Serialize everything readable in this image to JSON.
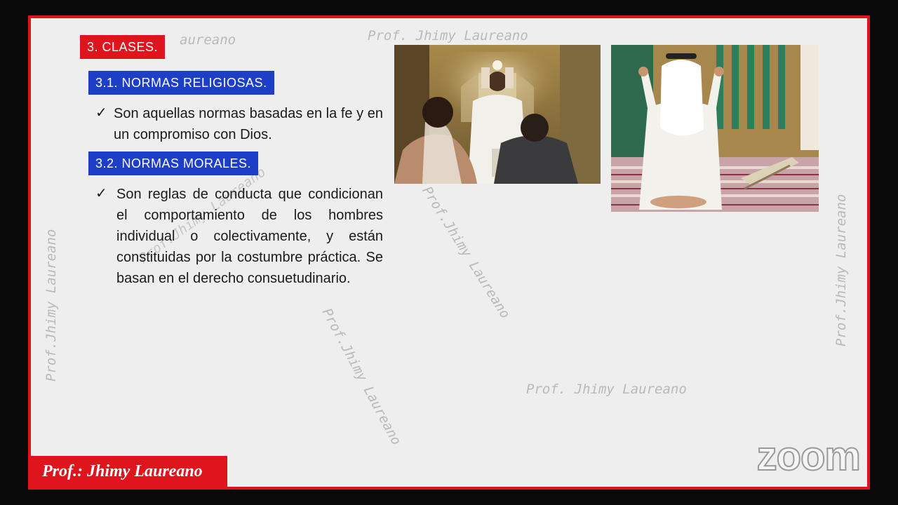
{
  "watermark": "Prof.Jhimy Laureano",
  "watermark_spaced": "Prof. Jhimy Laureano",
  "watermark_partial_top": "aureano",
  "section_title": "3. CLASES.",
  "subsections": [
    {
      "title": "3.1. NORMAS RELIGIOSAS.",
      "text": "Son aquellas normas basadas en la fe y en un compromiso con Dios."
    },
    {
      "title": "3.2. NORMAS MORALES.",
      "text": "Son reglas de conducta que condicionan el comportamiento de los hombres individual o colectivamente, y están constituidas por la costumbre práctica. Se basan en el derecho consuetudinario."
    }
  ],
  "check_glyph": "✓",
  "footer": "Prof.: Jhimy Laureano",
  "zoom_logo": "zoom"
}
